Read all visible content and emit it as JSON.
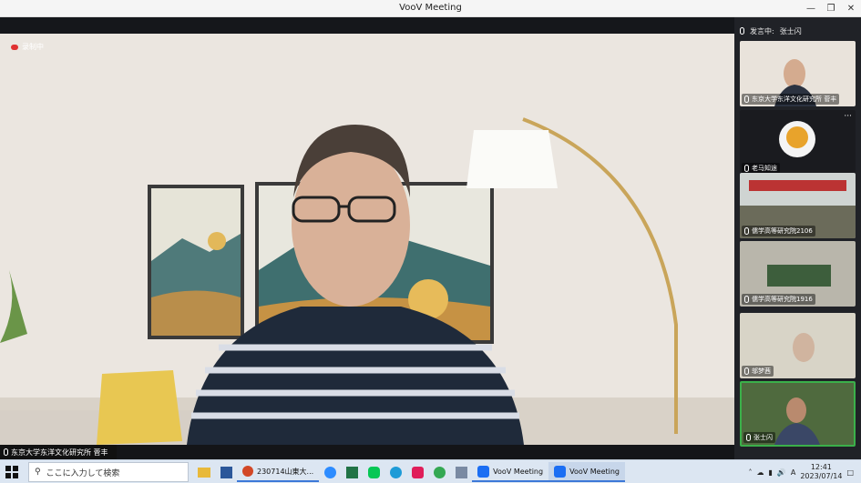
{
  "window": {
    "title": "VooV Meeting"
  },
  "recording": {
    "label": "录制中"
  },
  "main_speaker": {
    "name": "东京大学东洋文化研究所 菅丰"
  },
  "sidebar": {
    "speaking_label": "发言中:",
    "speaking_name": "张士闪",
    "thumbnails": [
      {
        "name": "东京大学东洋文化研究所 菅丰"
      },
      {
        "name": "老马知途"
      },
      {
        "name": "儒学高等研究院2106"
      },
      {
        "name": "儒学高等研究院1916"
      },
      {
        "name": "邬梦茜"
      },
      {
        "name": "张士闪"
      }
    ]
  },
  "taskbar": {
    "search_placeholder": "ここに入力して検索",
    "ppt_label": "230714山東大...",
    "voov1_label": "VooV Meeting",
    "voov2_label": "VooV Meeting",
    "time": "12:41",
    "date": "2023/07/14"
  }
}
